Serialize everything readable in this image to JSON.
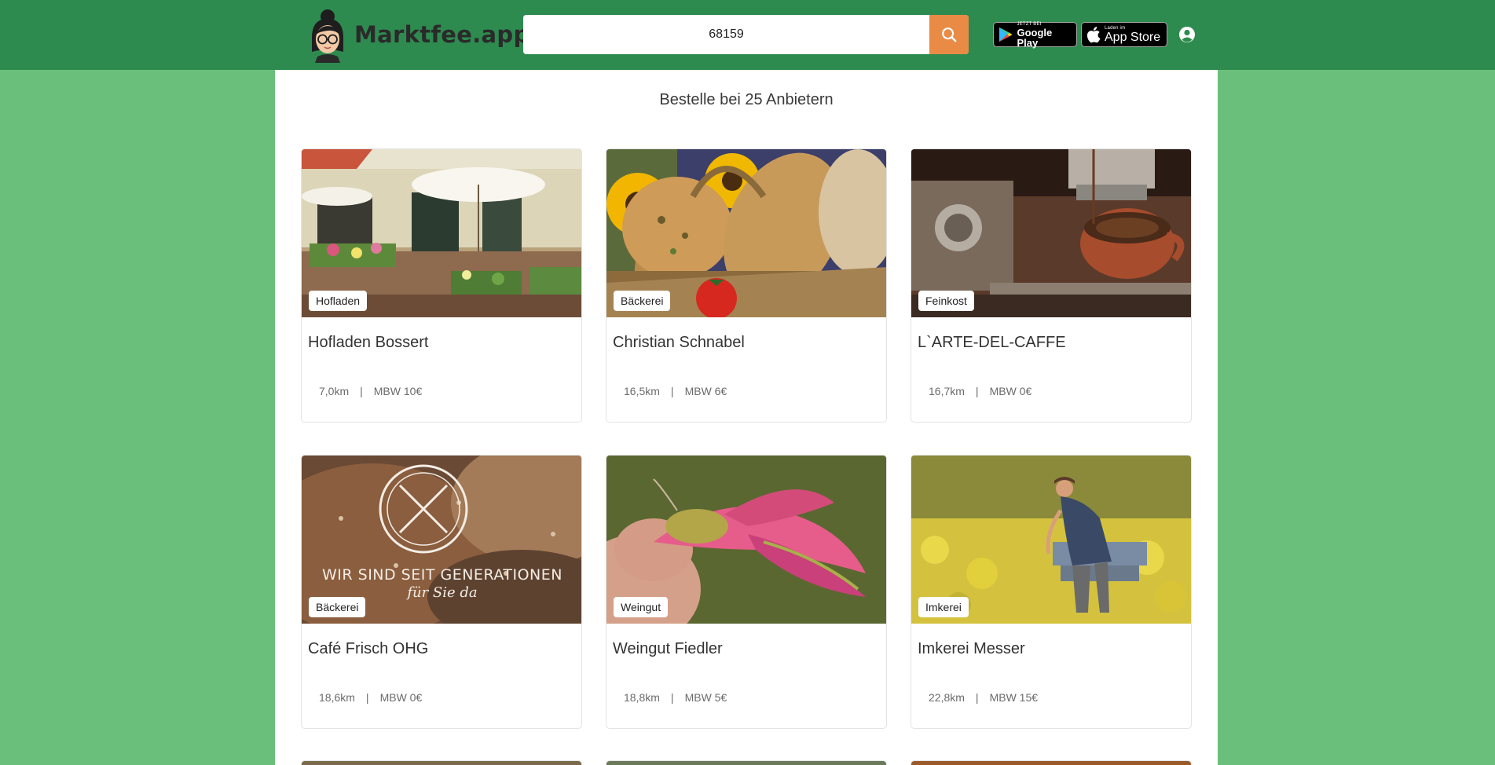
{
  "brand": {
    "name": "Marktfee.app"
  },
  "search": {
    "value": "68159"
  },
  "stores": {
    "google": {
      "small": "JETZT BEI",
      "big": "Google Play"
    },
    "apple": {
      "small": "Laden im",
      "big": "App Store"
    }
  },
  "main": {
    "heading": "Bestelle bei 25 Anbietern"
  },
  "vendors": [
    {
      "name": "Hofladen Bossert",
      "category": "Hofladen",
      "distance": "7,0km",
      "mbw": "MBW 10€"
    },
    {
      "name": "Christian Schnabel",
      "category": "Bäckerei",
      "distance": "16,5km",
      "mbw": "MBW 6€"
    },
    {
      "name": "L`ARTE-DEL-CAFFE",
      "category": "Feinkost",
      "distance": "16,7km",
      "mbw": "MBW 0€"
    },
    {
      "name": "Café Frisch OHG",
      "category": "Bäckerei",
      "distance": "18,6km",
      "mbw": "MBW 0€",
      "image_text": "WIR SIND SEIT GENERATIONEN",
      "image_script": "für Sie da"
    },
    {
      "name": "Weingut Fiedler",
      "category": "Weingut",
      "distance": "18,8km",
      "mbw": "MBW 5€"
    },
    {
      "name": "Imkerei Messer",
      "category": "Imkerei",
      "distance": "22,8km",
      "mbw": "MBW 15€"
    }
  ],
  "meta_separator": "|",
  "colors": {
    "header": "#2e8b4f",
    "background": "#6abf7b",
    "search_button": "#e98a45"
  },
  "icons": {
    "search": "search-icon",
    "user": "user-circle-icon",
    "google_play": "google-play-icon",
    "apple": "apple-icon"
  }
}
